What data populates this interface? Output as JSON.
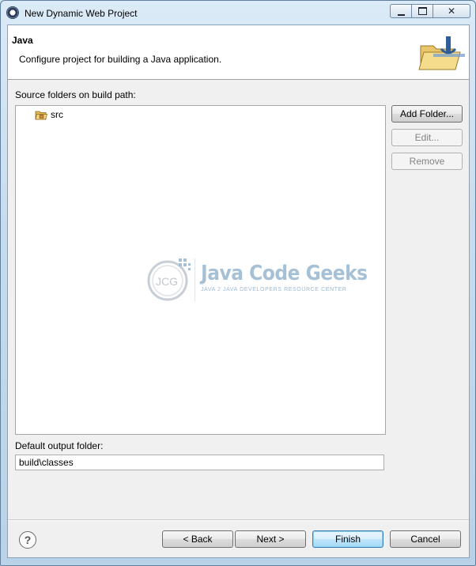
{
  "window": {
    "title": "New Dynamic Web Project",
    "controls": {
      "minimize": "minimize",
      "maximize": "maximize",
      "close": "✕"
    }
  },
  "header": {
    "title": "Java",
    "description": "Configure project for building a Java application."
  },
  "source_folders": {
    "label": "Source folders on build path:",
    "items": [
      {
        "name": "src",
        "icon": "package-folder-icon"
      }
    ],
    "buttons": {
      "add_folder": "Add Folder...",
      "edit": "Edit...",
      "remove": "Remove"
    }
  },
  "watermark": {
    "logo_letters": "JCG",
    "brand": "Java Code Geeks",
    "tagline": "JAVA 2 JAVA DEVELOPERS RESOURCE CENTER"
  },
  "output_folder": {
    "label": "Default output folder:",
    "value": "build\\classes"
  },
  "footer": {
    "help": "?",
    "back": "< Back",
    "next": "Next >",
    "finish": "Finish",
    "cancel": "Cancel"
  }
}
